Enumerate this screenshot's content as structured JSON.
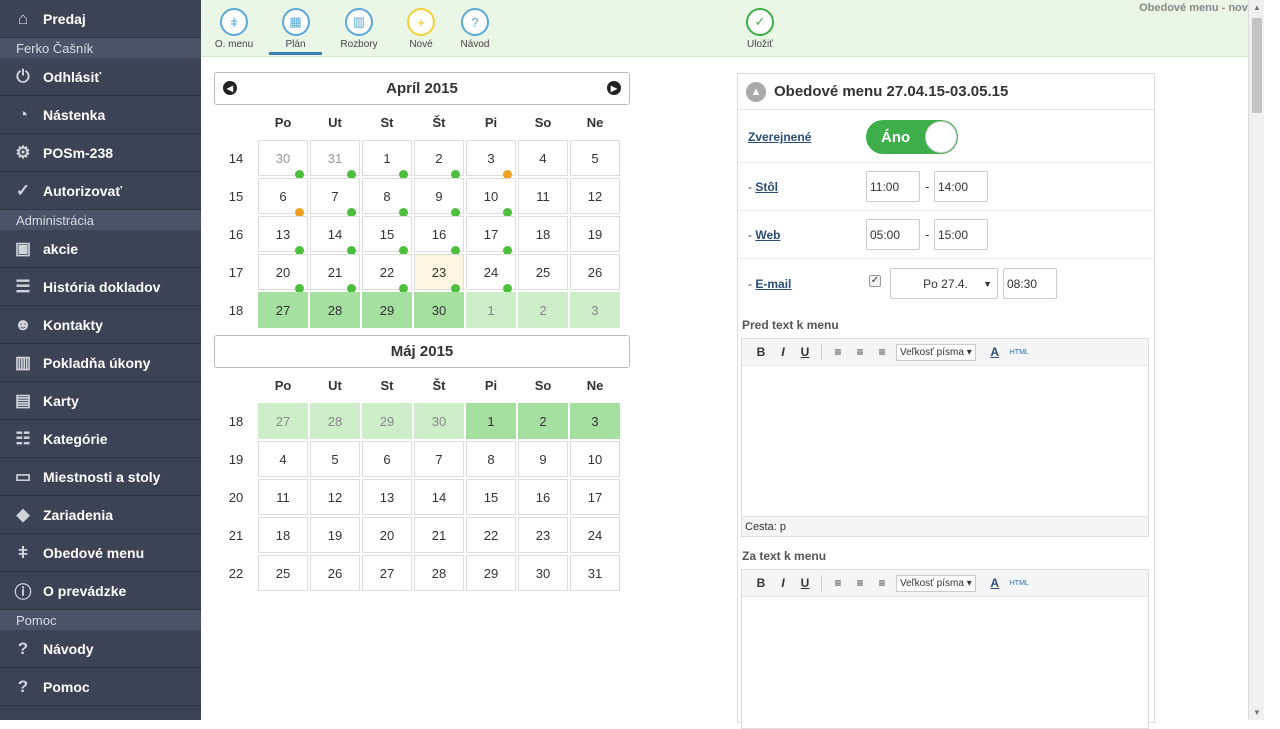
{
  "sidebar": {
    "top_item": {
      "label": "Predaj",
      "icon": "home-icon"
    },
    "user_section": "Ferko Čašník",
    "user_items": [
      {
        "label": "Odhlásiť",
        "icon": "power-icon"
      },
      {
        "label": "Nástenka",
        "icon": "dashboard-icon"
      },
      {
        "label": "POSm-238",
        "icon": "gear-icon"
      },
      {
        "label": "Autorizovať",
        "icon": "check-circle-icon"
      }
    ],
    "admin_section": "Administrácia",
    "admin_items": [
      {
        "label": "akcie",
        "icon": "boxes-star-icon"
      },
      {
        "label": "História dokladov",
        "icon": "list-icon"
      },
      {
        "label": "Kontakty",
        "icon": "users-icon"
      },
      {
        "label": "Pokladňa úkony",
        "icon": "bars-icon"
      },
      {
        "label": "Karty",
        "icon": "boxes-icon"
      },
      {
        "label": "Kategórie",
        "icon": "tree-icon"
      },
      {
        "label": "Miestnosti a stoly",
        "icon": "table-icon"
      },
      {
        "label": "Zariadenia",
        "icon": "diamond-icon"
      },
      {
        "label": "Obedové menu",
        "icon": "cutlery-icon"
      },
      {
        "label": "O prevádzke",
        "icon": "info-icon"
      }
    ],
    "help_section": "Pomoc",
    "help_items": [
      {
        "label": "Návody",
        "icon": "question-icon"
      },
      {
        "label": "Pomoc",
        "icon": "question-icon"
      }
    ]
  },
  "toolbar": {
    "buttons": [
      {
        "label": "O. menu",
        "icon": "cutlery-icon"
      },
      {
        "label": "Plán",
        "icon": "calendar-icon"
      },
      {
        "label": "Rozbory",
        "icon": "chart-icon"
      },
      {
        "label": "Nové",
        "icon": "plus-icon"
      },
      {
        "label": "Návod",
        "icon": "question-icon"
      },
      {
        "label": "Uložiť",
        "icon": "check-icon"
      }
    ],
    "title": "Obedové menu - nové"
  },
  "calendar": {
    "weekdays": [
      "Po",
      "Ut",
      "St",
      "Št",
      "Pi",
      "So",
      "Ne"
    ],
    "april": {
      "title": "Apríl 2015",
      "weeks": [
        {
          "wk": "14",
          "days": [
            [
              "30",
              "o",
              "g"
            ],
            [
              "31",
              "o",
              "g"
            ],
            [
              "1",
              "",
              "g"
            ],
            [
              "2",
              "",
              "g"
            ],
            [
              "3",
              "",
              "y"
            ],
            [
              "4",
              "",
              ""
            ],
            [
              "5",
              "",
              ""
            ]
          ]
        },
        {
          "wk": "15",
          "days": [
            [
              "6",
              "",
              "y"
            ],
            [
              "7",
              "",
              "g"
            ],
            [
              "8",
              "",
              "g"
            ],
            [
              "9",
              "",
              "g"
            ],
            [
              "10",
              "",
              "g"
            ],
            [
              "11",
              "",
              ""
            ],
            [
              "12",
              "",
              ""
            ]
          ]
        },
        {
          "wk": "16",
          "days": [
            [
              "13",
              "",
              "g"
            ],
            [
              "14",
              "",
              "g"
            ],
            [
              "15",
              "",
              "g"
            ],
            [
              "16",
              "",
              "g"
            ],
            [
              "17",
              "",
              "g"
            ],
            [
              "18",
              "",
              ""
            ],
            [
              "19",
              "",
              ""
            ]
          ]
        },
        {
          "wk": "17",
          "days": [
            [
              "20",
              "",
              "g"
            ],
            [
              "21",
              "",
              "g"
            ],
            [
              "22",
              "",
              "g"
            ],
            [
              "23",
              "t",
              "g"
            ],
            [
              "24",
              "",
              "g"
            ],
            [
              "25",
              "",
              ""
            ],
            [
              "26",
              "",
              ""
            ]
          ]
        },
        {
          "wk": "18",
          "days": [
            [
              "27",
              "s",
              ""
            ],
            [
              "28",
              "s",
              ""
            ],
            [
              "29",
              "s",
              ""
            ],
            [
              "30",
              "s",
              ""
            ],
            [
              "1",
              "l",
              ""
            ],
            [
              "2",
              "l",
              ""
            ],
            [
              "3",
              "l",
              ""
            ]
          ]
        }
      ]
    },
    "may": {
      "title": "Máj 2015",
      "weeks": [
        {
          "wk": "18",
          "days": [
            [
              "27",
              "l",
              ""
            ],
            [
              "28",
              "l",
              ""
            ],
            [
              "29",
              "l",
              ""
            ],
            [
              "30",
              "l",
              ""
            ],
            [
              "1",
              "s",
              ""
            ],
            [
              "2",
              "s",
              ""
            ],
            [
              "3",
              "s",
              ""
            ]
          ]
        },
        {
          "wk": "19",
          "days": [
            [
              "4",
              "",
              ""
            ],
            [
              "5",
              "",
              ""
            ],
            [
              "6",
              "",
              ""
            ],
            [
              "7",
              "",
              ""
            ],
            [
              "8",
              "",
              ""
            ],
            [
              "9",
              "",
              ""
            ],
            [
              "10",
              "",
              ""
            ]
          ]
        },
        {
          "wk": "20",
          "days": [
            [
              "11",
              "",
              ""
            ],
            [
              "12",
              "",
              ""
            ],
            [
              "13",
              "",
              ""
            ],
            [
              "14",
              "",
              ""
            ],
            [
              "15",
              "",
              ""
            ],
            [
              "16",
              "",
              ""
            ],
            [
              "17",
              "",
              ""
            ]
          ]
        },
        {
          "wk": "21",
          "days": [
            [
              "18",
              "",
              ""
            ],
            [
              "19",
              "",
              ""
            ],
            [
              "20",
              "",
              ""
            ],
            [
              "21",
              "",
              ""
            ],
            [
              "22",
              "",
              ""
            ],
            [
              "23",
              "",
              ""
            ],
            [
              "24",
              "",
              ""
            ]
          ]
        },
        {
          "wk": "22",
          "days": [
            [
              "25",
              "",
              ""
            ],
            [
              "26",
              "",
              ""
            ],
            [
              "27",
              "",
              ""
            ],
            [
              "28",
              "",
              ""
            ],
            [
              "29",
              "",
              ""
            ],
            [
              "30",
              "",
              ""
            ],
            [
              "31",
              "",
              ""
            ]
          ]
        }
      ]
    }
  },
  "panel": {
    "title": "Obedové menu 27.04.15-03.05.15",
    "published_label": "Zverejnené",
    "published_value": "Áno",
    "stol_prefix": "- ",
    "stol_label": "Stôl",
    "stol_from": "11:00",
    "stol_to": "14:00",
    "web_prefix": "- ",
    "web_label": "Web",
    "web_from": "05:00",
    "web_to": "15:00",
    "email_prefix": "- ",
    "email_label": "E-mail",
    "email_day": "Po 27.4.",
    "email_time": "08:30",
    "dash": "-",
    "pre_text_label": "Pred text k menu",
    "post_text_label": "Za text k menu",
    "font_size_label": "Veľkosť písma",
    "path_label": "Cesta: p",
    "html_label": "HTML"
  }
}
